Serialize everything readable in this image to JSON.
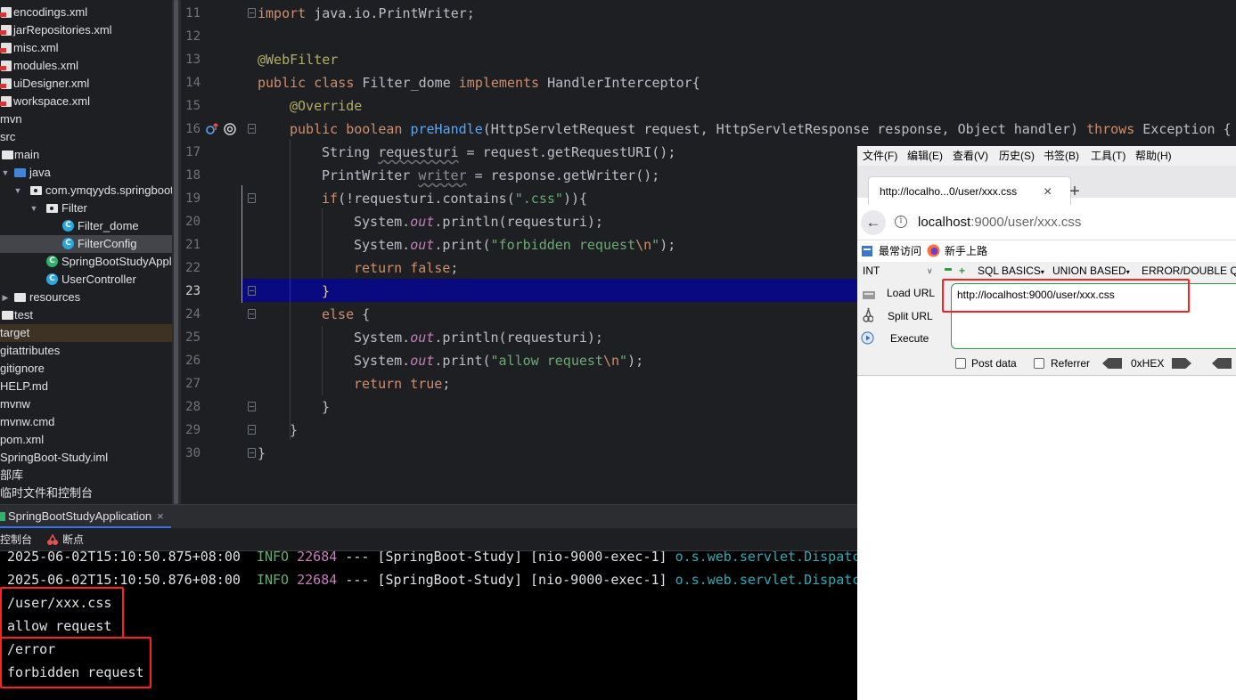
{
  "tree": {
    "items": [
      {
        "label": "encodings.xml",
        "icon": "xml-file-icon"
      },
      {
        "label": "jarRepositories.xml",
        "icon": "xml-file-icon"
      },
      {
        "label": "misc.xml",
        "icon": "xml-file-icon"
      },
      {
        "label": "modules.xml",
        "icon": "xml-file-icon"
      },
      {
        "label": "uiDesigner.xml",
        "icon": "xml-file-icon"
      },
      {
        "label": "workspace.xml",
        "icon": "xml-file-icon"
      },
      {
        "label": "mvn",
        "icon": ""
      },
      {
        "label": "src",
        "icon": ""
      },
      {
        "label": "main",
        "icon": "folder-icon"
      },
      {
        "label": "java",
        "icon": "source-folder-icon"
      },
      {
        "label": "com.ymqyyds.springboot",
        "icon": "package-icon"
      },
      {
        "label": "Filter",
        "icon": "package-icon"
      },
      {
        "label": "Filter_dome",
        "icon": "class-icon",
        "badge": "C"
      },
      {
        "label": "FilterConfig",
        "icon": "class-icon",
        "badge": "C"
      },
      {
        "label": "SpringBootStudyApplication",
        "icon": "spring-app-icon",
        "badge": "C"
      },
      {
        "label": "UserController",
        "icon": "class-icon",
        "badge": "C"
      },
      {
        "label": "resources",
        "icon": "folder-icon"
      },
      {
        "label": "test",
        "icon": "folder-icon"
      },
      {
        "label": "target",
        "icon": ""
      },
      {
        "label": "gitattributes",
        "icon": ""
      },
      {
        "label": "gitignore",
        "icon": ""
      },
      {
        "label": "HELP.md",
        "icon": ""
      },
      {
        "label": "mvnw",
        "icon": ""
      },
      {
        "label": "mvnw.cmd",
        "icon": ""
      },
      {
        "label": "pom.xml",
        "icon": ""
      },
      {
        "label": "SpringBoot-Study.iml",
        "icon": ""
      },
      {
        "label": "部库",
        "icon": ""
      },
      {
        "label": "临时文件和控制台",
        "icon": ""
      }
    ]
  },
  "editor": {
    "line_numbers": [
      "11",
      "12",
      "13",
      "14",
      "15",
      "16",
      "17",
      "18",
      "19",
      "20",
      "21",
      "22",
      "23",
      "24",
      "25",
      "26",
      "27",
      "28",
      "29",
      "30"
    ],
    "current_line": "23",
    "lines": {
      "l11": [
        "import",
        " java.io.PrintWriter;"
      ],
      "l13": [
        "@WebFilter"
      ],
      "l14": [
        "public",
        " ",
        "class",
        " Filter_dome ",
        "implements",
        " HandlerInterceptor{"
      ],
      "l15": [
        "@Override"
      ],
      "l16": [
        "public",
        " ",
        "boolean",
        " ",
        "preHandle",
        "(HttpServletRequest request, HttpServletResponse response, Object handler) ",
        "throws",
        " Exception {"
      ],
      "l17": [
        "String ",
        "requesturi",
        " = request.getRequestURI();"
      ],
      "l18": [
        "PrintWriter ",
        "writer",
        " = response.getWriter();"
      ],
      "l19": [
        "if",
        "(!requesturi.contains(",
        "\".css\"",
        ")){"
      ],
      "l20": [
        "System.",
        "out",
        ".println(requesturi);"
      ],
      "l21": [
        "System.",
        "out",
        ".print(",
        "\"forbidden request",
        "\\n",
        "\"",
        ");"
      ],
      "l22": [
        "return",
        " ",
        "false",
        ";"
      ],
      "l23": [
        "}"
      ],
      "l24": [
        "else",
        " {"
      ],
      "l25": [
        "System.",
        "out",
        ".println(requesturi);"
      ],
      "l26": [
        "System.",
        "out",
        ".print(",
        "\"allow request",
        "\\n",
        "\"",
        ");"
      ],
      "l27": [
        "return",
        " ",
        "true",
        ";"
      ],
      "l28": [
        "}"
      ],
      "l29": [
        "}"
      ],
      "l30": [
        "}"
      ]
    }
  },
  "run": {
    "tab_label": "SpringBootStudyApplication",
    "close": "×",
    "console_label": "控制台",
    "breakpoints_label": "断点",
    "log": [
      {
        "ts": "2025-06-02T15:10:50.875+08:00",
        "level": "INFO",
        "pid": "22684",
        "sep": "---",
        "app": "[SpringBoot-Study]",
        "thread": "[nio-9000-exec-1]",
        "logger": "o.s.web.servlet.Dispatc"
      },
      {
        "ts": "2025-06-02T15:10:50.876+08:00",
        "level": "INFO",
        "pid": "22684",
        "sep": "---",
        "app": "[SpringBoot-Study]",
        "thread": "[nio-9000-exec-1]",
        "logger": "o.s.web.servlet.Dispatc"
      }
    ],
    "output": [
      "/user/xxx.css",
      "allow request",
      "/error",
      "forbidden request"
    ]
  },
  "firefox": {
    "menu": [
      "文件(F)",
      "编辑(E)",
      "查看(V)",
      "历史(S)",
      "书签(B)",
      "工具(T)",
      "帮助(H)"
    ],
    "tab_title": "http://localho...0/user/xxx.css",
    "tab_close": "×",
    "new_tab": "+",
    "url_host": "localhost",
    "url_rest": ":9000/user/xxx.css",
    "bookmarks": [
      "最常访问",
      "新手上路"
    ],
    "hackbar": {
      "dropdown": "INT",
      "menus": [
        "SQL BASICS",
        "UNION BASED",
        "ERROR/DOUBLE Q"
      ],
      "load_url": "Load URL",
      "split_url": "Split URL",
      "execute": "Execute",
      "input_value": "http://localhost:9000/user/xxx.css",
      "post_data": "Post data",
      "referrer": "Referrer",
      "hex": "0xHEX"
    }
  },
  "colors": {
    "highlight_box": "#ff2020",
    "current_line": "#0a0a80",
    "keyword": "#cf8e6d",
    "string": "#6aab73",
    "function": "#56a8f5"
  }
}
